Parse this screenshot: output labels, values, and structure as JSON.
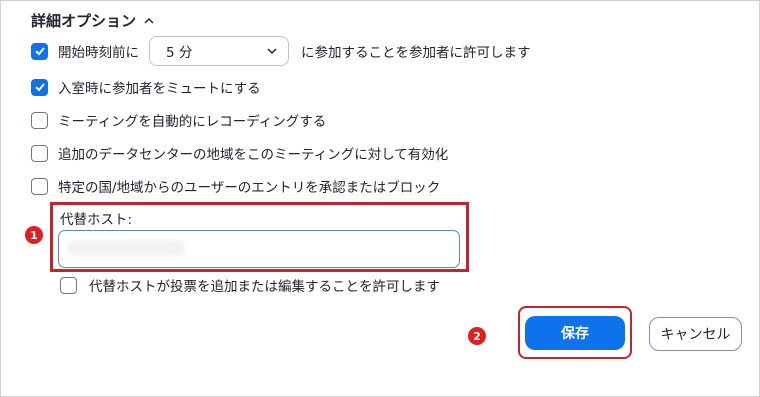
{
  "section": {
    "title": "詳細オプション"
  },
  "options": {
    "join_before": {
      "checked": true,
      "label_before": "開始時刻前に",
      "select_value": "5 分",
      "label_after": "に参加することを参加者に許可します"
    },
    "mute_on_entry": {
      "checked": true,
      "label": "入室時に参加者をミュートにする"
    },
    "auto_record": {
      "checked": false,
      "label": "ミーティングを自動的にレコーディングする"
    },
    "data_center": {
      "checked": false,
      "label": "追加のデータセンターの地域をこのミーティングに対して有効化"
    },
    "country_block": {
      "checked": false,
      "label": "特定の国/地域からのユーザーのエントリを承認またはブロック"
    }
  },
  "alternative_host": {
    "label": "代替ホスト:",
    "value": "",
    "allow_polls": {
      "checked": false,
      "label": "代替ホストが投票を追加または編集することを許可します"
    }
  },
  "annotations": {
    "step1": "1",
    "step2": "2",
    "highlight_color": "#c0272d"
  },
  "buttons": {
    "save": "保存",
    "cancel": "キャンセル"
  },
  "colors": {
    "primary": "#0e72ed",
    "badge": "#e02020"
  }
}
